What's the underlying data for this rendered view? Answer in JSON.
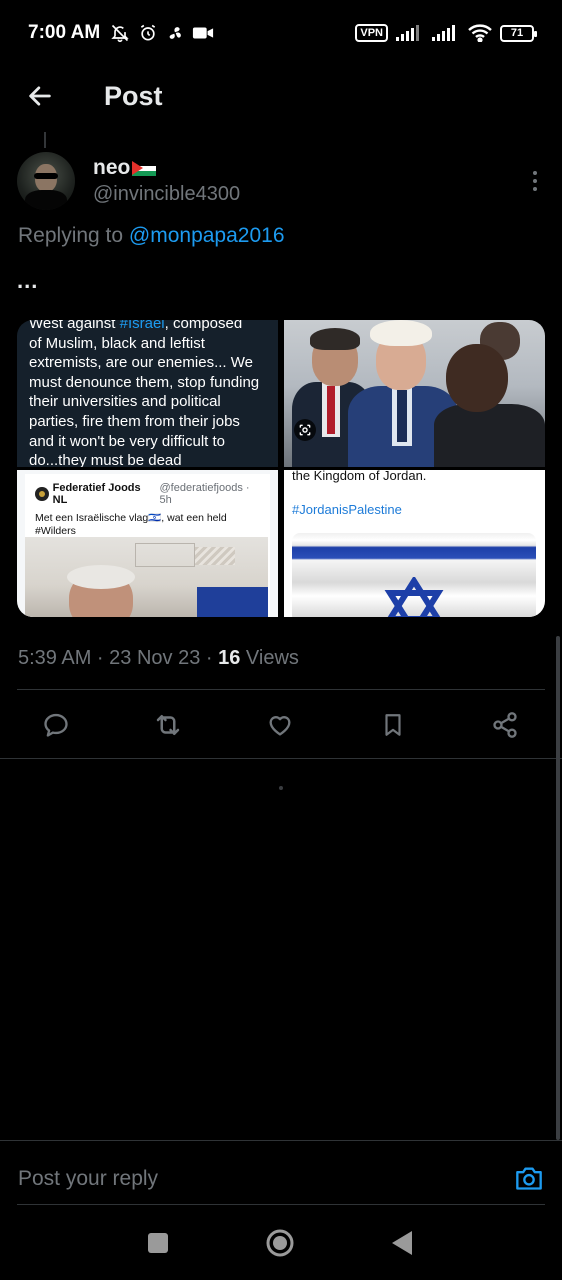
{
  "status_bar": {
    "time": "7:00 AM",
    "vpn": "VPN",
    "battery": "71"
  },
  "header": {
    "title": "Post"
  },
  "post": {
    "author_name": "neo",
    "author_handle": "@invincible4300",
    "replying_prefix": "Replying to",
    "replying_handle": "@monpapa2016",
    "text": "...",
    "timestamp": "5:39 AM · 23 Nov 23 · ",
    "views_count": "16",
    "views_label": " Views"
  },
  "media": {
    "image1": {
      "line_top_prefix": "West against ",
      "line_top_tag": "#Israel",
      "line_top_suffix": ", composed",
      "body": "of Muslim, black and leftist extremists, are our enemies... We must denounce them, stop funding their universities and political parties, fire them from their jobs and it won't be very difficult to do...they must be dead"
    },
    "image3": {
      "account_name": "Federatief Joods NL",
      "account_meta": "@federatiefjoods · 5h",
      "body_line1": "Met een Israëlische vlag🇮🇱, wat een held",
      "body_line2": "#Wilders"
    },
    "image4": {
      "line1": "the Kingdom of Jordan.",
      "tag": "#JordanisPalestine"
    }
  },
  "reply": {
    "placeholder": "Post your reply"
  },
  "colors": {
    "background": "#000000",
    "text_primary": "#e7e9ea",
    "text_secondary": "#71767b",
    "accent": "#1d9bf0",
    "divider": "#2f3336"
  },
  "icons": {
    "back": "arrow-left-icon",
    "more": "more-vertical-icon",
    "reply": "comment-icon",
    "repost": "repost-icon",
    "like": "heart-icon",
    "bookmark": "bookmark-icon",
    "share": "share-icon",
    "camera": "camera-icon"
  }
}
